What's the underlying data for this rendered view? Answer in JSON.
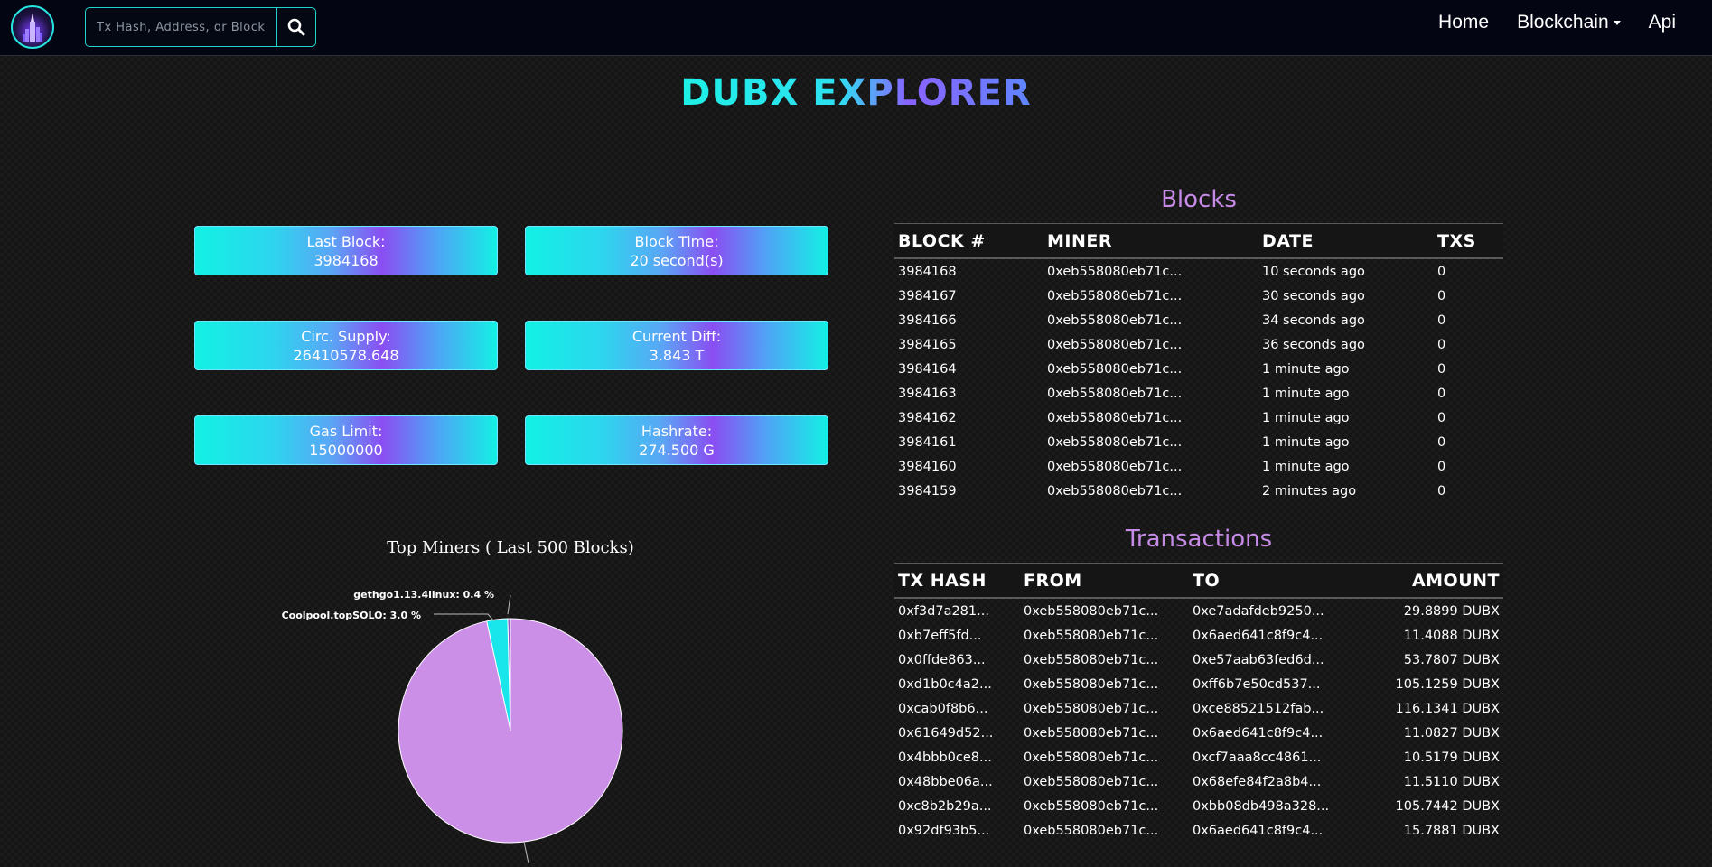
{
  "nav": {
    "search_placeholder": "Tx Hash, Address, or Block #",
    "links": [
      {
        "label": "Home"
      },
      {
        "label": "Blockchain"
      },
      {
        "label": "Api"
      }
    ]
  },
  "title": "DUBX EXPLORER",
  "stats": [
    {
      "label": "Last Block:",
      "value": "3984168"
    },
    {
      "label": "Block Time:",
      "value": "20 second(s)"
    },
    {
      "label": "Circ. Supply:",
      "value": "26410578.648"
    },
    {
      "label": "Current Diff:",
      "value": "3.843 T"
    },
    {
      "label": "Gas Limit:",
      "value": "15000000"
    },
    {
      "label": "Hashrate:",
      "value": "274.500 G"
    }
  ],
  "blocks": {
    "title": "Blocks",
    "headers": [
      "BLOCK #",
      "MINER",
      "DATE",
      "TXS"
    ],
    "rows": [
      {
        "block": "3984168",
        "miner": "0xeb558080eb71c...",
        "date": "10 seconds ago",
        "txs": "0"
      },
      {
        "block": "3984167",
        "miner": "0xeb558080eb71c...",
        "date": "30 seconds ago",
        "txs": "0"
      },
      {
        "block": "3984166",
        "miner": "0xeb558080eb71c...",
        "date": "34 seconds ago",
        "txs": "0"
      },
      {
        "block": "3984165",
        "miner": "0xeb558080eb71c...",
        "date": "36 seconds ago",
        "txs": "0"
      },
      {
        "block": "3984164",
        "miner": "0xeb558080eb71c...",
        "date": "1 minute ago",
        "txs": "0"
      },
      {
        "block": "3984163",
        "miner": "0xeb558080eb71c...",
        "date": "1 minute ago",
        "txs": "0"
      },
      {
        "block": "3984162",
        "miner": "0xeb558080eb71c...",
        "date": "1 minute ago",
        "txs": "0"
      },
      {
        "block": "3984161",
        "miner": "0xeb558080eb71c...",
        "date": "1 minute ago",
        "txs": "0"
      },
      {
        "block": "3984160",
        "miner": "0xeb558080eb71c...",
        "date": "1 minute ago",
        "txs": "0"
      },
      {
        "block": "3984159",
        "miner": "0xeb558080eb71c...",
        "date": "2 minutes ago",
        "txs": "0"
      }
    ]
  },
  "transactions": {
    "title": "Transactions",
    "headers": [
      "TX HASH",
      "FROM",
      "TO",
      "AMOUNT"
    ],
    "rows": [
      {
        "hash": "0xf3d7a281...",
        "from": "0xeb558080eb71c...",
        "to": "0xe7adafdeb9250...",
        "amount": "29.8899 DUBX"
      },
      {
        "hash": "0xb7eff5fd...",
        "from": "0xeb558080eb71c...",
        "to": "0x6aed641c8f9c4...",
        "amount": "11.4088 DUBX"
      },
      {
        "hash": "0x0ffde863...",
        "from": "0xeb558080eb71c...",
        "to": "0xe57aab63fed6d...",
        "amount": "53.7807 DUBX"
      },
      {
        "hash": "0xd1b0c4a2...",
        "from": "0xeb558080eb71c...",
        "to": "0xff6b7e50cd537...",
        "amount": "105.1259 DUBX"
      },
      {
        "hash": "0xcab0f8b6...",
        "from": "0xeb558080eb71c...",
        "to": "0xce88521512fab...",
        "amount": "116.1341 DUBX"
      },
      {
        "hash": "0x61649d52...",
        "from": "0xeb558080eb71c...",
        "to": "0x6aed641c8f9c4...",
        "amount": "11.0827 DUBX"
      },
      {
        "hash": "0x4bbb0ce8...",
        "from": "0xeb558080eb71c...",
        "to": "0xcf7aaa8cc4861...",
        "amount": "10.5179 DUBX"
      },
      {
        "hash": "0x48bbe06a...",
        "from": "0xeb558080eb71c...",
        "to": "0x68efe84f2a8b4...",
        "amount": "11.5110 DUBX"
      },
      {
        "hash": "0xc8b2b29a...",
        "from": "0xeb558080eb71c...",
        "to": "0xbb08db498a328...",
        "amount": "105.7442 DUBX"
      },
      {
        "hash": "0x92df93b5...",
        "from": "0xeb558080eb71c...",
        "to": "0x6aed641c8f9c4...",
        "amount": "15.7881 DUBX"
      }
    ]
  },
  "chart_data": {
    "type": "pie",
    "title": "Top Miners ( Last 500 Blocks)",
    "labels": [
      "gethgo1.13.4linux",
      "Coolpool.topSOLO",
      ""
    ],
    "values": [
      0.4,
      3.0,
      96.6
    ],
    "slice_labels": [
      "gethgo1.13.4linux: 0.4 %",
      "Coolpool.topSOLO: 3.0 %"
    ],
    "colors": [
      "#8a5cc6",
      "#19e6ea",
      "#cc8fe8"
    ]
  },
  "colors": {
    "accent_cyan": "#14e0dc",
    "accent_purple": "#c58be6",
    "nav_bg": "#030512"
  }
}
